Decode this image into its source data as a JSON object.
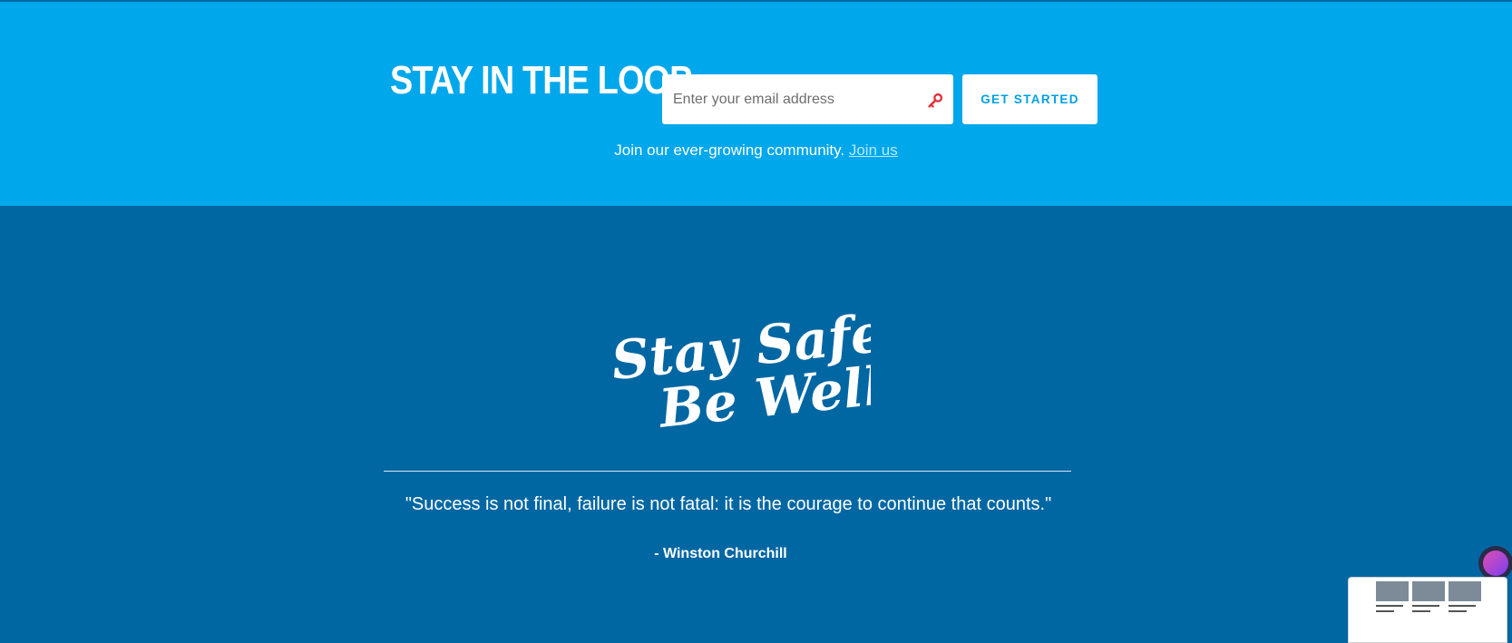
{
  "newsletter": {
    "title": "STAY IN THE LOOP",
    "email_placeholder": "Enter your email address",
    "cta_label": "GET STARTED",
    "join_text": "Join our ever-growing community.",
    "join_link": "Join us"
  },
  "footer": {
    "logo_line1": "Stay Safe,",
    "logo_line2": "Be Well.",
    "quote": "\"Success is not final, failure is not fatal: it is the courage to continue that counts.\"",
    "author": "- Winston Churchill"
  },
  "colors": {
    "newsletter_bg": "#00a7eb",
    "footer_bg": "#0167a3",
    "cta_text": "#00a0e2",
    "key_icon": "#e0313a"
  },
  "icons": [
    "key-icon",
    "assistant-icon"
  ]
}
